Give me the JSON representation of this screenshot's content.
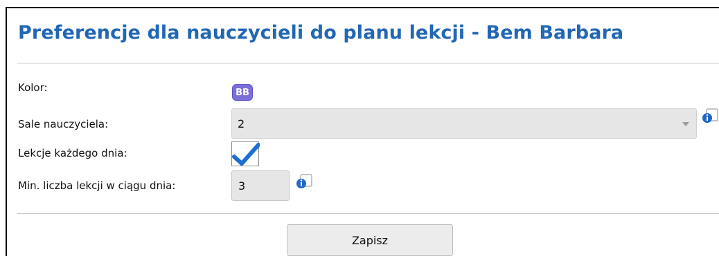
{
  "page": {
    "title": "Preferencje dla nauczycieli do planu lekcji - Bem Barbara"
  },
  "form": {
    "color": {
      "label": "Kolor:",
      "badge": "BB",
      "badge_color": "#7b6fd8"
    },
    "rooms": {
      "label": "Sale nauczyciela:",
      "value": "2"
    },
    "daily": {
      "label": "Lekcje każdego dnia:",
      "checked": true
    },
    "min_lessons": {
      "label": "Min. liczba lekcji w ciągu dnia:",
      "value": "3"
    }
  },
  "actions": {
    "save_label": "Zapisz"
  },
  "colors": {
    "title": "#2167b4",
    "check": "#1f6fd1",
    "info": "#2266c8"
  },
  "icons": [
    "info-icon",
    "chevron-down-icon",
    "checkmark-icon"
  ]
}
